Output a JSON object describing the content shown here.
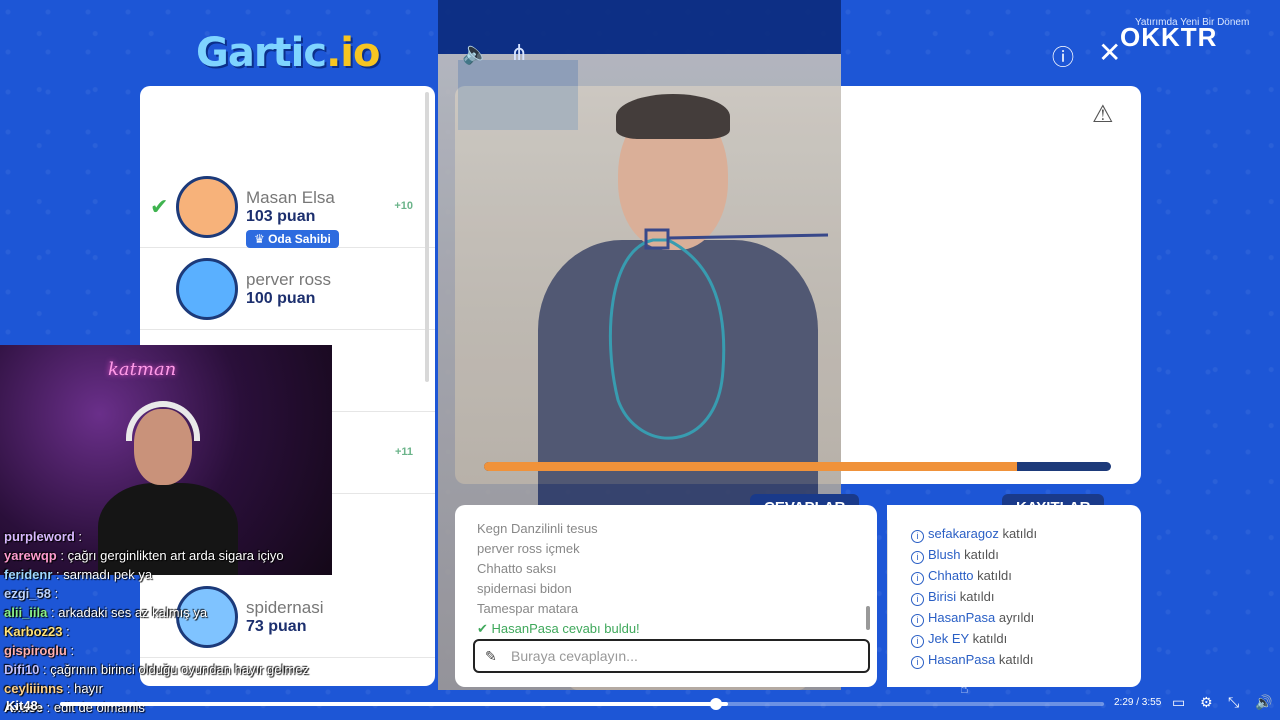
{
  "logo": {
    "main": "Gartic",
    "suffix": ".io"
  },
  "players": [
    {
      "name": "Masan Elsa",
      "points": "103 puan",
      "plus": "+10",
      "badge": "Oda Sahibi",
      "checked": true
    },
    {
      "name": "perver ross",
      "points": "100 puan",
      "plus": "",
      "badge": "",
      "checked": false
    },
    {
      "name": "",
      "points": "",
      "plus": "+11",
      "badge": "",
      "checked": false
    },
    {
      "name": "spidernasi",
      "points": "73 puan",
      "plus": "",
      "badge": "",
      "checked": false
    }
  ],
  "tabs": {
    "answers": "CEVAPLAR",
    "logs": "KAYITLAR"
  },
  "answers": {
    "items": [
      "Kegn Danzilinli tesus",
      "perver ross içmek",
      "Chhatto saksı",
      "spidernasi bidon",
      "Tamespar matara"
    ],
    "success": "HasanPasa cevabı buldu!",
    "input_placeholder": "Buraya cevaplayın..."
  },
  "logs": [
    {
      "user": "sefakaragoz",
      "action": "katıldı"
    },
    {
      "user": "Blush",
      "action": "katıldı"
    },
    {
      "user": "Chhatto",
      "action": "katıldı"
    },
    {
      "user": "Birisi",
      "action": "katıldı"
    },
    {
      "user": "HasanPasa",
      "action": "ayrıldı"
    },
    {
      "user": "Jek EY",
      "action": "katıldı"
    },
    {
      "user": "HasanPasa",
      "action": "katıldı"
    }
  ],
  "progress": {
    "fraction": 0.85
  },
  "brand": {
    "name": "OKKTR",
    "sub": "Yatırımda Yeni Bir Dönem"
  },
  "webcam": {
    "sign": "katman"
  },
  "chat": [
    {
      "user": "purpleword",
      "text": ":",
      "color": "#d9b8ff"
    },
    {
      "user": "yarewqp",
      "text": ": çağrı gerginlikten art arda sigara içiyo",
      "color": "#ff9cd0"
    },
    {
      "user": "feridenr",
      "text": ": sarmadı pek ya",
      "color": "#9fd7ff"
    },
    {
      "user": "ezgi_58",
      "text": ":",
      "color": "#bcd4ff"
    },
    {
      "user": "alii_iila",
      "text": ": arkadaki ses az kalmış ya",
      "color": "#8af28a"
    },
    {
      "user": "Karboz23",
      "text": ":",
      "color": "#ffe27a"
    },
    {
      "user": "gispiroglu",
      "text": ":",
      "color": "#ffb0b0"
    },
    {
      "user": "Difi10",
      "text": ": çağrının birinci olduğu oyundan hayır gelmez",
      "color": "#c0c0ff"
    },
    {
      "user": "ceyliiinns",
      "text": ": hayır",
      "color": "#ffd28a"
    },
    {
      "user": "Axuse",
      "text": ": edit de olmamis",
      "color": "#ffffff"
    }
  ],
  "player": {
    "time": "2:29 / 3:55",
    "played_fraction": 0.64,
    "kit": "Kit48"
  }
}
